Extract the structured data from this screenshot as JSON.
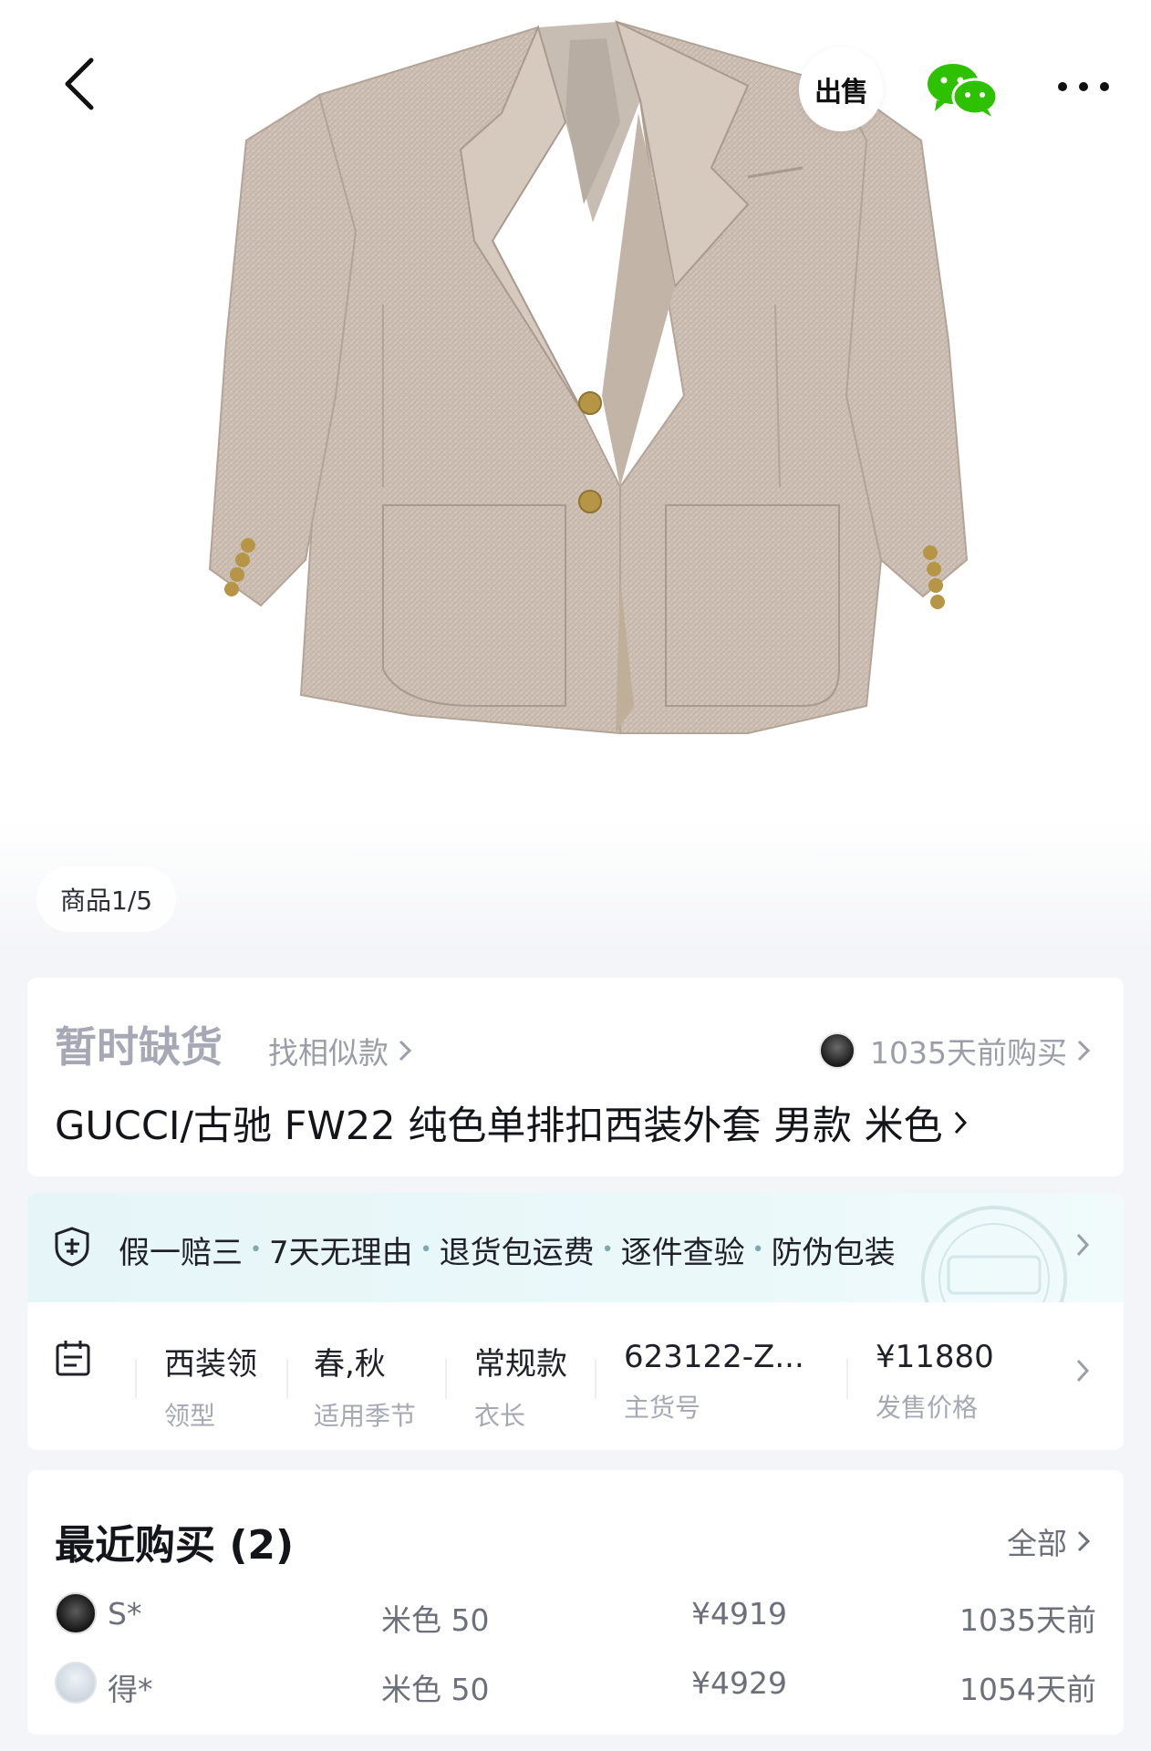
{
  "header": {
    "sell_label": "出售"
  },
  "gallery": {
    "counter": "商品1/5"
  },
  "product": {
    "stock_status": "暂时缺货",
    "similar_link": "找相似款",
    "recent_buy_note": "1035天前购买",
    "name": "GUCCI/古驰 FW22 纯色单排扣西装外套 男款 米色"
  },
  "guarantee": {
    "items": [
      "假一赔三",
      "7天无理由",
      "退货包运费",
      "逐件查验",
      "防伪包装"
    ]
  },
  "specs": [
    {
      "value": "西装领",
      "key": "领型"
    },
    {
      "value": "春,秋",
      "key": "适用季节"
    },
    {
      "value": "常规款",
      "key": "衣长"
    },
    {
      "value": "623122-Z...",
      "key": "主货号"
    },
    {
      "value": "¥11880",
      "key": "发售价格"
    }
  ],
  "recent": {
    "title": "最近购买 (2)",
    "all_label": "全部",
    "rows": [
      {
        "name": "S*",
        "spec": "米色 50",
        "price": "¥4919",
        "time": "1035天前"
      },
      {
        "name": "得*",
        "spec": "米色 50",
        "price": "¥4929",
        "time": "1054天前"
      }
    ]
  },
  "colors": {
    "accent_teal": "#e6f5f7",
    "muted_text": "#a6a8b5",
    "jacket_beige": "#cdbfb4"
  },
  "icons": [
    "back-arrow-icon",
    "sell-icon",
    "wechat-icon",
    "more-dots-icon",
    "shield-icon",
    "calendar-icon",
    "chevron-right-icon"
  ]
}
